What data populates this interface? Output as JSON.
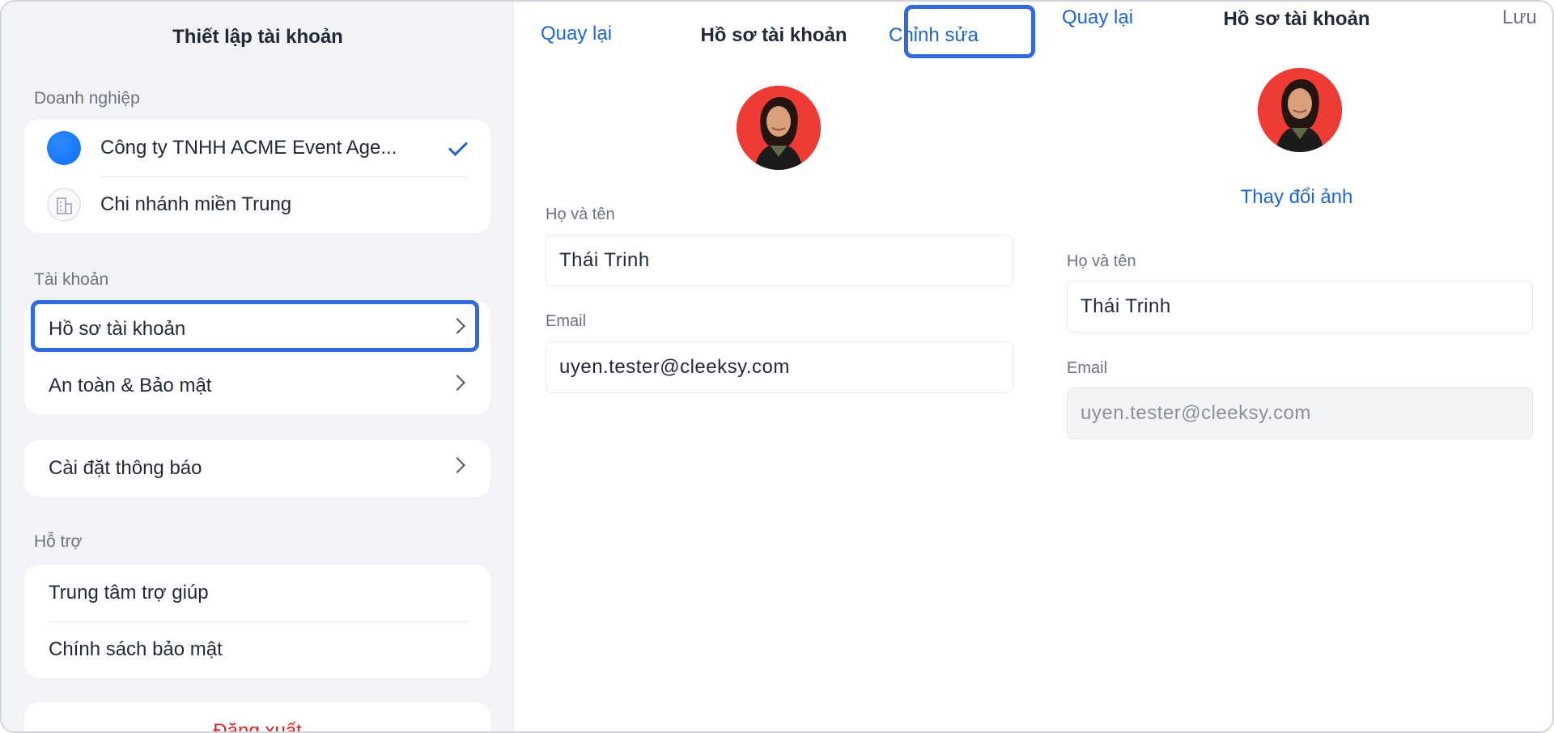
{
  "settings": {
    "title": "Thiết lập tài khoản",
    "business_label": "Doanh nghiệp",
    "business_items": [
      {
        "label": "Công ty TNHH ACME Event Age...",
        "selected": true
      },
      {
        "label": "Chi nhánh miền Trung",
        "selected": false
      }
    ],
    "account_label": "Tài khoản",
    "account_items": [
      {
        "label": "Hồ sơ tài khoản"
      },
      {
        "label": "An toàn & Bảo mật"
      }
    ],
    "notification_item": {
      "label": "Cài đặt thông báo"
    },
    "support_label": "Hỗ trợ",
    "support_items": [
      {
        "label": "Trung tâm trợ giúp"
      },
      {
        "label": "Chính sách bảo mật"
      }
    ],
    "logout_label": "Đăng xuất"
  },
  "profile_view": {
    "back_label": "Quay lại",
    "title": "Hồ sơ tài khoản",
    "edit_label": "Chỉnh sửa",
    "name_label": "Họ và tên",
    "name_value": "Thái Trinh",
    "email_label": "Email",
    "email_value": "uyen.tester@cleeksy.com"
  },
  "profile_edit": {
    "back_label": "Quay lại",
    "title": "Hồ sơ tài khoản",
    "save_label": "Lưu",
    "change_photo_label": "Thay đổi ảnh",
    "name_label": "Họ và tên",
    "name_value": "Thái Trinh",
    "email_label": "Email",
    "email_value": "uyen.tester@cleeksy.com"
  },
  "colors": {
    "accent": "#1e66d0",
    "highlight": "#2f6bdf",
    "danger": "#e02424",
    "panel_bg": "#f2f3f6"
  }
}
